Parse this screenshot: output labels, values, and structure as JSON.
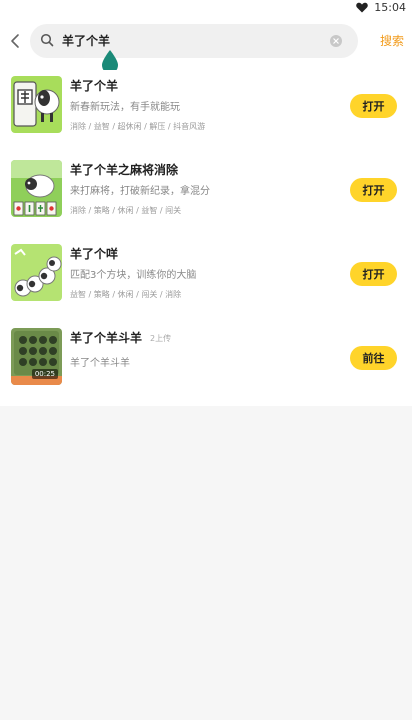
{
  "status_bar": {
    "time": "15:04"
  },
  "search": {
    "query": "羊了个羊",
    "submit_label": "搜索"
  },
  "results": [
    {
      "title": "羊了个羊",
      "desc": "新春新玩法，有手就能玩",
      "tags": "消除 / 益智 / 超休闲 / 解压 / 抖音风游",
      "action": "打开"
    },
    {
      "title": "羊了个羊之麻将消除",
      "desc": "来打麻将，打破新纪录，拿混分",
      "tags": "消除 / 策略 / 休闲 / 益智 / 闯关",
      "action": "打开"
    },
    {
      "title": "羊了个咩",
      "desc": "匹配3个方块，训练你的大脑",
      "tags": "益智 / 策略 / 休闲 / 闯关 / 消除",
      "action": "打开"
    },
    {
      "title": "羊了个羊斗羊",
      "badge": "2上传",
      "desc": "羊了个羊斗羊",
      "video_time": "00:25",
      "action": "前往"
    }
  ],
  "colors": {
    "accent_button": "#ffd42a",
    "search_link": "#f29b1b",
    "cursor": "#1a8a78"
  },
  "icons": [
    "back-arrow-icon",
    "search-icon",
    "clear-icon",
    "heart-icon"
  ]
}
